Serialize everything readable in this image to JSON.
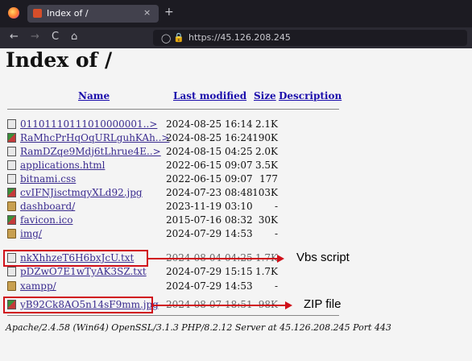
{
  "browser": {
    "tab_title": "Index of /",
    "tab_close": "×",
    "new_tab": "+",
    "url": "https://45.126.208.245",
    "back": "←",
    "forward": "→",
    "reload": "C",
    "home": "⌂"
  },
  "page": {
    "title": "Index of /",
    "columns": [
      "Name",
      "Last modified",
      "Size",
      "Description"
    ],
    "rows": [
      {
        "name": "01101110111010000001..>",
        "modified": "2024-08-25 16:14",
        "size": "2.1K",
        "icon": "text-file-icon"
      },
      {
        "name": "RaMhcPrHqOqURLguhKAh..>",
        "modified": "2024-08-25 16:24",
        "size": "190K",
        "icon": "image-file-icon"
      },
      {
        "name": "RamDZqe9Mdj6tLhrue4E..>",
        "modified": "2024-08-15 04:25",
        "size": "2.0K",
        "icon": "text-file-icon"
      },
      {
        "name": "applications.html",
        "modified": "2022-06-15 09:07",
        "size": "3.5K",
        "icon": "text-file-icon"
      },
      {
        "name": "bitnami.css",
        "modified": "2022-06-15 09:07",
        "size": "177",
        "icon": "text-file-icon"
      },
      {
        "name": "cvIFNJisctmqyXLd92.jpg",
        "modified": "2024-07-23 08:48",
        "size": "103K",
        "icon": "image-file-icon"
      },
      {
        "name": "dashboard/",
        "modified": "2023-11-19 03:10",
        "size": "-",
        "icon": "folder-icon"
      },
      {
        "name": "favicon.ico",
        "modified": "2015-07-16 08:32",
        "size": "30K",
        "icon": "image-file-icon"
      },
      {
        "name": "img/",
        "modified": "2024-07-29 14:53",
        "size": "-",
        "icon": "folder-icon"
      },
      {
        "name": "nkXhhzeT6H6bxJcU.txt",
        "modified": "2024-08-04 04:25",
        "size": "1.7K",
        "icon": "text-file-icon"
      },
      {
        "name": "pDZwO7E1wTyAK3SZ.txt",
        "modified": "2024-07-29 15:15",
        "size": "1.7K",
        "icon": "text-file-icon"
      },
      {
        "name": "xampp/",
        "modified": "2024-07-29 14:53",
        "size": "-",
        "icon": "folder-icon"
      },
      {
        "name": "yB92Ck8AO5n14sF9mm.jpg",
        "modified": "2024-08-07 18:51",
        "size": "98K",
        "icon": "image-file-icon"
      }
    ],
    "footer": "Apache/2.4.58 (Win64) OpenSSL/3.1.3 PHP/8.2.12 Server at 45.126.208.245 Port 443"
  },
  "annotations": {
    "vbs_label": "Vbs script",
    "zip_label": "ZIP file",
    "color": "#d0101a"
  }
}
